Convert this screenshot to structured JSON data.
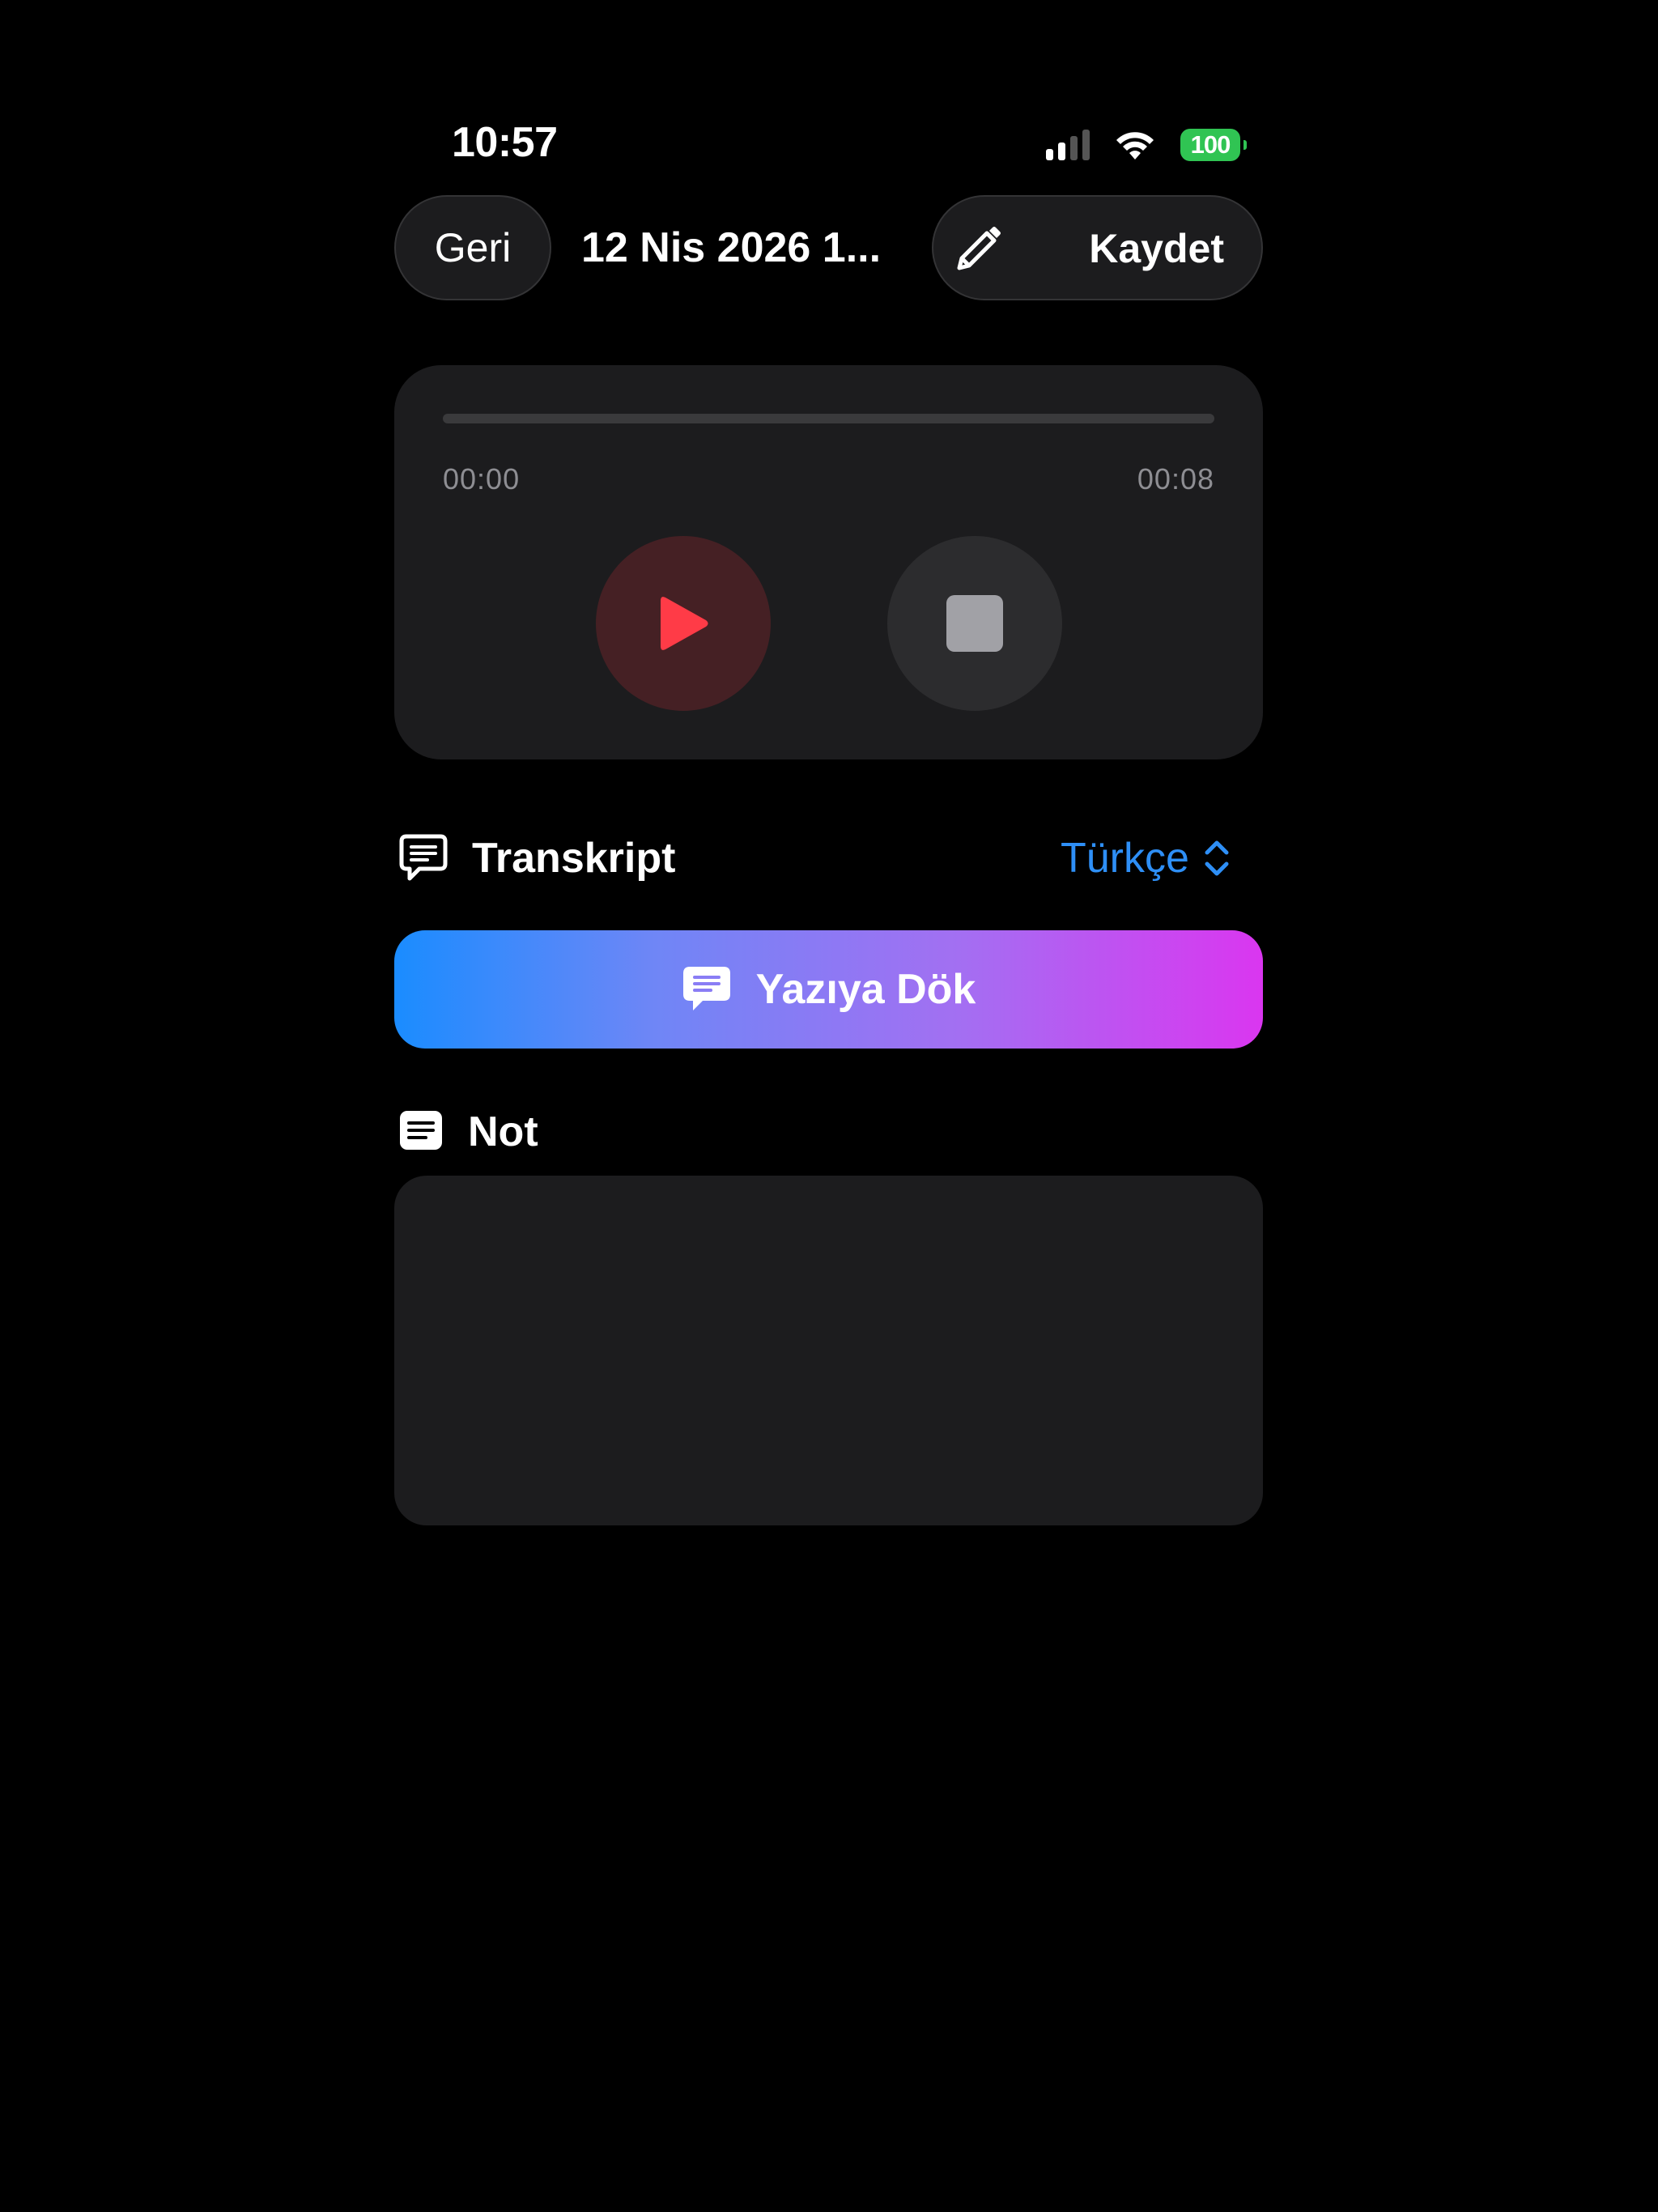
{
  "status_bar": {
    "time": "10:57",
    "battery_level": "100",
    "signal_bars_active": 2,
    "signal_bars_total": 4,
    "icons": [
      "cellular-signal-icon",
      "wifi-icon",
      "battery-icon"
    ],
    "battery_color": "#30c453"
  },
  "nav": {
    "back_label": "Geri",
    "title": "12 Nis 2026 1...",
    "edit_icon": "pencil-icon",
    "save_label": "Kaydet"
  },
  "player": {
    "current_time": "00:00",
    "duration": "00:08",
    "progress": 0,
    "play_icon": "play-icon",
    "stop_icon": "stop-icon",
    "play_color": "#ff3b47"
  },
  "transcript": {
    "title": "Transkript",
    "icon": "chat-bubble-icon",
    "language": "Türkçe",
    "language_icon": "chevron-up-down-icon",
    "accent_color": "#2e8ff6",
    "action_label": "Yazıya Dök",
    "action_icon": "chat-bubble-filled-icon",
    "gradient_colors": [
      "#1a8cff",
      "#da36f0"
    ]
  },
  "note": {
    "title": "Not",
    "icon": "note-icon",
    "content": ""
  }
}
